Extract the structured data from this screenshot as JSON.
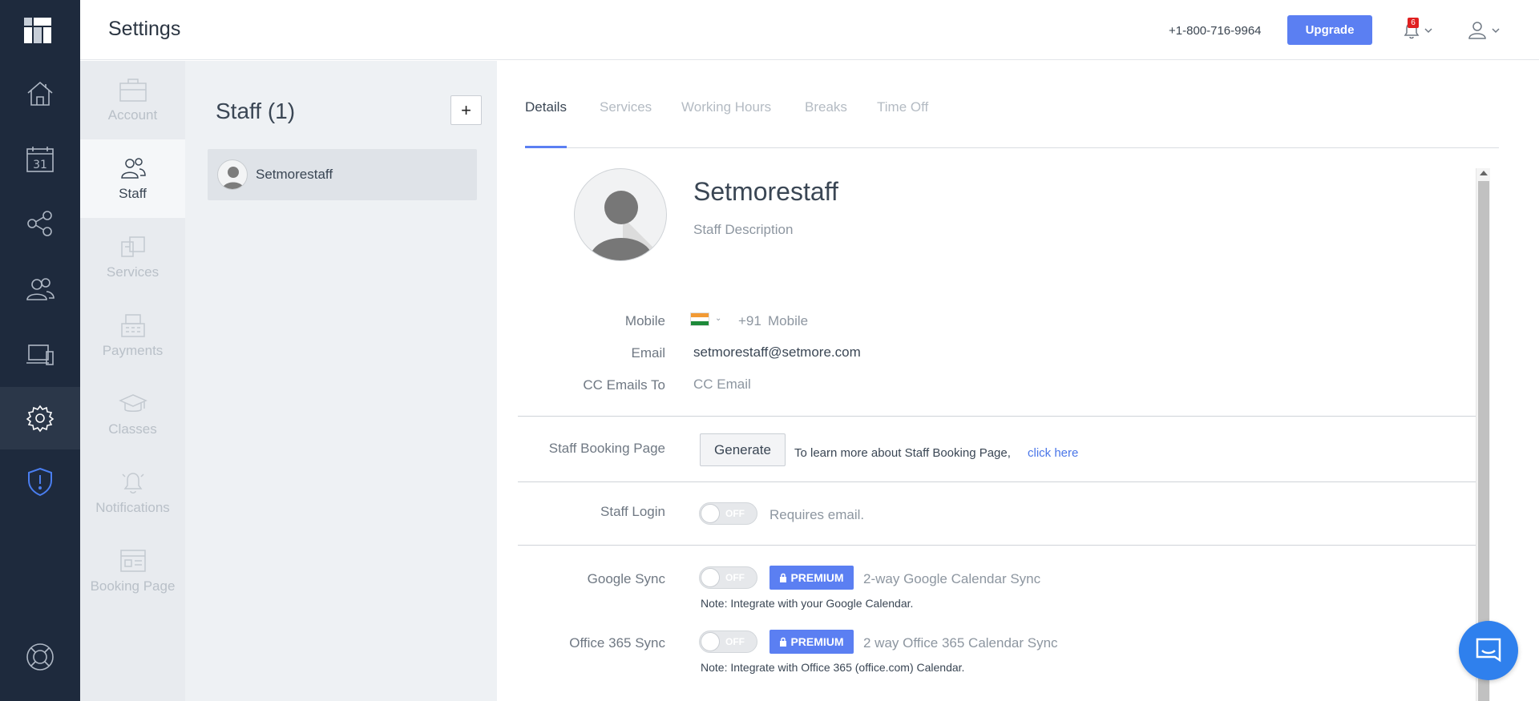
{
  "header": {
    "title": "Settings",
    "phone": "+1-800-716-9964",
    "upgrade_label": "Upgrade",
    "notification_count": "6"
  },
  "rail": {
    "items": [
      "home-icon",
      "calendar-icon",
      "share-icon",
      "customers-icon",
      "devices-icon",
      "settings-icon",
      "shield-alert-icon",
      "help-lifebuoy-icon"
    ],
    "calendar_day": "31",
    "active": "settings-icon"
  },
  "subnav": {
    "items": [
      {
        "label": "Account",
        "icon": "briefcase-icon"
      },
      {
        "label": "Staff",
        "icon": "staff-icon",
        "active": true
      },
      {
        "label": "Services",
        "icon": "services-icon"
      },
      {
        "label": "Payments",
        "icon": "register-icon"
      },
      {
        "label": "Classes",
        "icon": "graduation-cap-icon"
      },
      {
        "label": "Notifications",
        "icon": "bell-icon"
      },
      {
        "label": "Booking Page",
        "icon": "booking-page-icon"
      }
    ]
  },
  "staff_list": {
    "title": "Staff (1)",
    "add_label": "+",
    "items": [
      {
        "name": "Setmorestaff"
      }
    ]
  },
  "tabs": [
    {
      "label": "Details",
      "active": true
    },
    {
      "label": "Services"
    },
    {
      "label": "Working Hours"
    },
    {
      "label": "Breaks"
    },
    {
      "label": "Time Off"
    }
  ],
  "profile": {
    "name": "Setmorestaff",
    "description_placeholder": "Staff Description"
  },
  "fields": {
    "mobile_label": "Mobile",
    "mobile_code": "+91",
    "mobile_placeholder": "Mobile",
    "email_label": "Email",
    "email_value": "setmorestaff@setmore.com",
    "cc_label": "CC Emails To",
    "cc_placeholder": "CC Email"
  },
  "booking_page": {
    "label": "Staff Booking Page",
    "generate_label": "Generate",
    "info_text": "To learn more about Staff Booking Page,",
    "link_text": "click here"
  },
  "staff_login": {
    "label": "Staff Login",
    "toggle": "OFF",
    "hint": "Requires email."
  },
  "google_sync": {
    "label": "Google Sync",
    "toggle": "OFF",
    "badge": "PREMIUM",
    "desc": "2-way Google Calendar Sync",
    "note": "Note: Integrate with your Google Calendar."
  },
  "office_sync": {
    "label": "Office 365 Sync",
    "toggle": "OFF",
    "badge": "PREMIUM",
    "desc": "2 way Office 365 Calendar Sync",
    "note": "Note: Integrate with Office 365 (office.com) Calendar."
  },
  "colors": {
    "rail_bg": "#1e2a3d",
    "accent": "#5b7ff2",
    "badge_red": "#e02020",
    "chat_blue": "#2f80ed"
  }
}
